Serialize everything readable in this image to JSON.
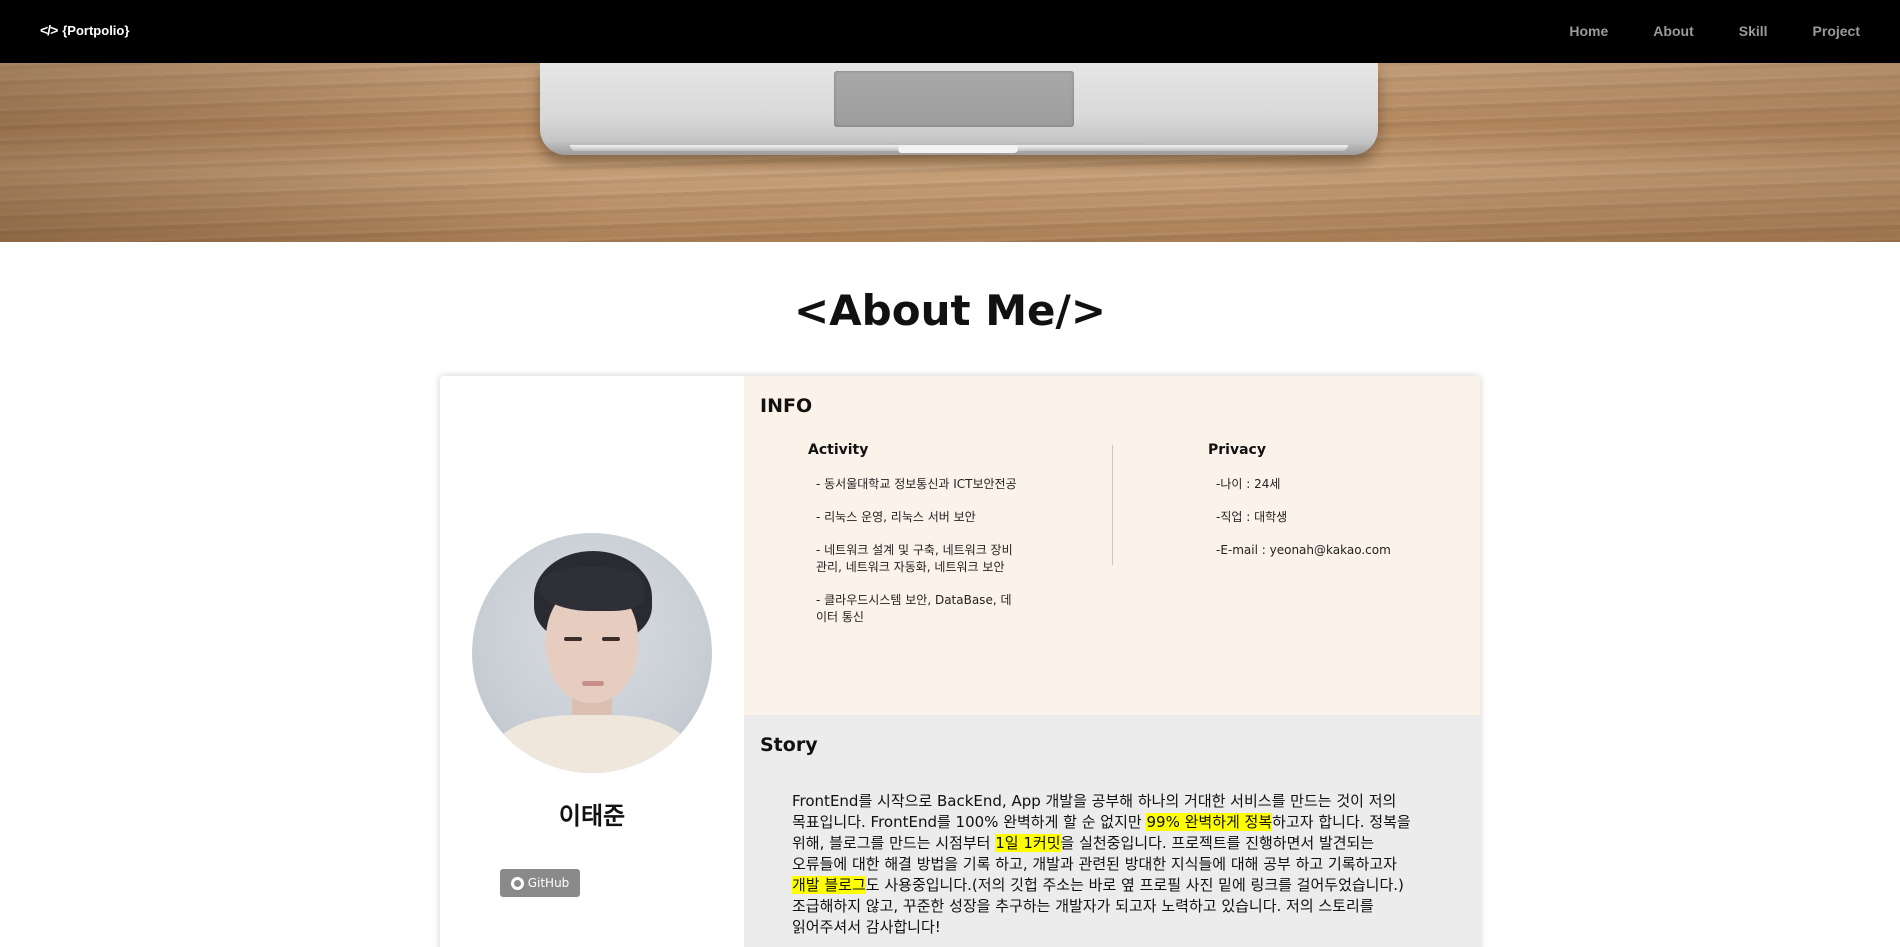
{
  "nav": {
    "brand_icon": "</>",
    "brand": "{Portpolio}",
    "links": [
      "Home",
      "About",
      "Skill",
      "Project"
    ]
  },
  "about": {
    "title": "<About Me/>"
  },
  "profile": {
    "name": "이태준",
    "github_label": "GitHub"
  },
  "info": {
    "title": "INFO",
    "activity_title": "Activity",
    "activities": [
      "- 동서울대학교 정보통신과 ICT보안전공",
      "- 리눅스 운영, 리눅스 서버 보안",
      "- 네트워크 설계 및 구축, 네트워크 장비관리, 네트워크 자동화, 네트워크 보안",
      "- 클라우드시스템 보안, DataBase, 데이터 통신"
    ],
    "privacy_title": "Privacy",
    "privacy": [
      "-나이 : 24세",
      "-직업 : 대학생",
      "-E-mail : yeonah@kakao.com"
    ]
  },
  "story": {
    "title": "Story",
    "p1": "FrontEnd를 시작으로 BackEnd, App 개발을 공부해 하나의 거대한 서비스를 만드는 것이 저의 목표입니다. FrontEnd를 100% 완벽하게 할 순 없지만 ",
    "h1": "99% 완벽하게 정복",
    "p2": "하고자 합니다. 정복을 위해, 블로그를 만드는 시점부터 ",
    "h2": "1일 1커밋",
    "p3": "을 실천중입니다. 프로젝트를 진행하면서 발견되는 오류들에 대한 해결 방법을 기록 하고, 개발과 관련된 방대한 지식들에 대해 공부 하고 기록하고자 ",
    "h3": "개발 블로그",
    "p4": "도 사용중입니다.(저의 깃헙 주소는 바로 옆 프로필 사진 밑에 링크를 걸어두었습니다.) 조급해하지 않고, 꾸준한 성장을 추구하는 개발자가 되고자 노력하고 있습니다. 저의 스토리를 읽어주셔서 감사합니다!"
  },
  "colors": {
    "navbar": "#000000",
    "info_bg": "#fbf3e9",
    "story_bg": "#ececec",
    "highlight": "#ffff00",
    "github_button": "#8a8a8a"
  },
  "icons": {
    "brand": "code-icon",
    "github": "github-icon"
  }
}
